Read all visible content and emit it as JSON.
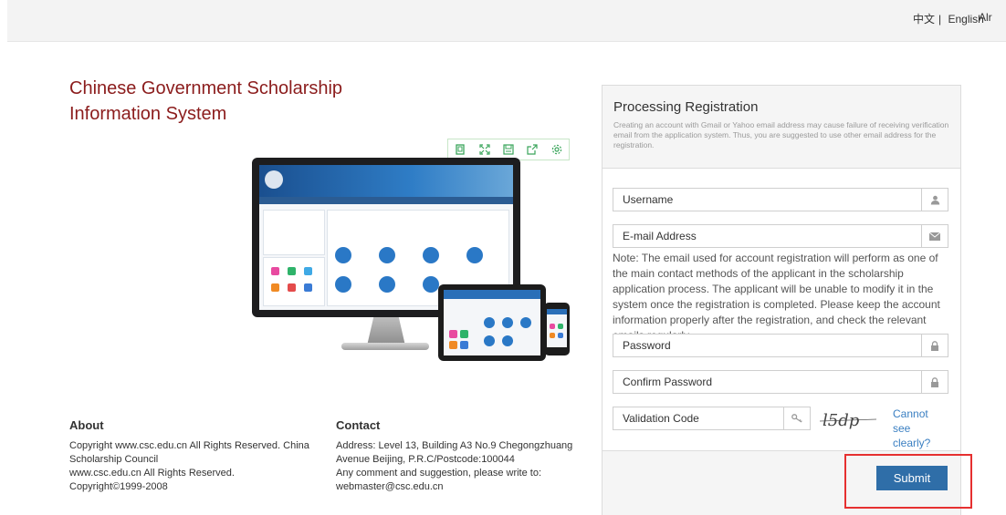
{
  "header": {
    "lang_zh": "中文",
    "lang_sep": "|",
    "lang_en": "English",
    "already_partial": "Alr"
  },
  "site_title_line1": "Chinese Government Scholarship",
  "site_title_line2": "Information System",
  "tools": [
    "copy-icon",
    "fullscreen-icon",
    "save-icon",
    "share-icon",
    "settings-icon"
  ],
  "footer": {
    "about_heading": "About",
    "about_lines": [
      "Copyright www.csc.edu.cn All Rights Reserved. China",
      "Scholarship Council",
      "www.csc.edu.cn All Rights Reserved.",
      "Copyright©1999-2008"
    ],
    "contact_heading": "Contact",
    "contact_lines": [
      "Address: Level 13, Building A3 No.9 Chegongzhuang",
      "Avenue Beijing, P.R.C/Postcode:100044",
      "Any comment and suggestion, please write to:",
      "webmaster@csc.edu.cn"
    ]
  },
  "registration": {
    "title": "Processing Registration",
    "note": "Creating an account with Gmail or Yahoo email address may cause failure of receiving verification email from the application system. Thus, you are suggested to use other email address for the registration.",
    "username_placeholder": "Username",
    "email_placeholder": "E-mail Address",
    "email_note": "Note: The email used for account registration will perform as one of the main contact methods of the applicant in the scholarship application process. The applicant will be unable to modify it in the system once the registration is completed. Please keep the account information properly after the registration, and check the relevant emails regularly.",
    "password_placeholder": "Password",
    "confirm_placeholder": "Confirm Password",
    "validation_placeholder": "Validation Code",
    "captcha_text": "l5dp",
    "cannot_see": "Cannot see clearly?",
    "submit_label": "Submit"
  },
  "colors": {
    "title": "#8b1c1c",
    "submit": "#2f6ea8",
    "highlight": "#e63030",
    "link": "#3a7fc2"
  }
}
